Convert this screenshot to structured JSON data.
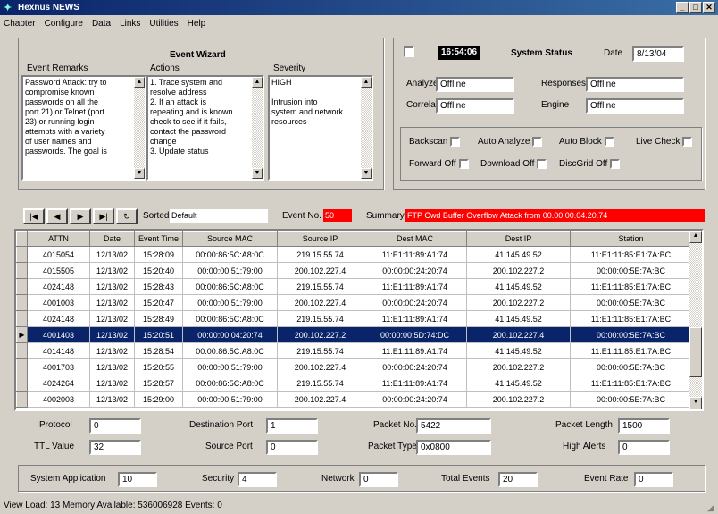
{
  "window": {
    "title": "Hexnus NEWS"
  },
  "menu": [
    "Chapter",
    "Configure",
    "Data",
    "Links",
    "Utilities",
    "Help"
  ],
  "wizard": {
    "title": "Event Wizard",
    "remarks_label": "Event Remarks",
    "actions_label": "Actions",
    "severity_label": "Severity",
    "remarks_lines": [
      "Password Attack: try to",
      "compromise known",
      "passwords on all the",
      "port 21) or Telnet (port",
      "23) or running login",
      "attempts with a variety",
      "of user names and",
      "passwords. The goal is"
    ],
    "actions_lines": [
      "1. Trace system and",
      "resolve address",
      "2. If an attack is",
      "repeating and is known",
      "check to see if it fails,",
      "contact the password",
      "change",
      "3. Update status"
    ],
    "severity_lines": [
      "HIGH",
      "",
      "Intrusion into",
      "system and network",
      "resources"
    ]
  },
  "status_panel": {
    "time_value": "16:54:06",
    "system_status_label": "System Status",
    "date_label": "Date",
    "date_value": "8/13/04",
    "analyzer_label": "Analyzer",
    "analyzer_value": "Offline",
    "responses_label": "Responses",
    "responses_value": "Offline",
    "correlation_label": "Correlation",
    "correlation_value": "Offline",
    "engine_label": "Engine",
    "engine_value": "Offline",
    "checks": [
      "Backscan",
      "Auto Analyze",
      "Auto Block",
      "Live Check",
      "Forward Off",
      "Download Off",
      "DiscGrid Off"
    ]
  },
  "nav": {
    "buttons": [
      "|◀",
      "◀",
      "▶",
      "▶|",
      "↻"
    ],
    "sorting_label": "Sorted",
    "sorting_value": "Default",
    "event_no_label": "Event No.",
    "event_no_value": "50",
    "summary_label": "Summary",
    "summary_value": "FTP Cwd Buffer Overflow Attack from 00.00.00.04.20.74"
  },
  "table": {
    "columns": [
      "ATTN",
      "Date",
      "Event Time",
      "Source MAC",
      "Source IP",
      "Dest MAC",
      "Dest IP",
      "Station"
    ],
    "rows": [
      [
        "4015054",
        "12/13/02",
        "15:28:09",
        "00:00:86:5C:A8:0C",
        "219.15.55.74",
        "11:E1:11:89:A1:74",
        "41.145.49.52",
        "11:E1:11:85:E1:7A:BC"
      ],
      [
        "4015505",
        "12/13/02",
        "15:20:40",
        "00:00:00:51:79:00",
        "200.102.227.4",
        "00:00:00:24:20:74",
        "200.102.227.2",
        "00:00:00:5E:7A:BC"
      ],
      [
        "4024148",
        "12/13/02",
        "15:28:43",
        "00:00:86:5C:A8:0C",
        "219.15.55.74",
        "11:E1:11:89:A1:74",
        "41.145.49.52",
        "11:E1:11:85:E1:7A:BC"
      ],
      [
        "4001003",
        "12/13/02",
        "15:20:47",
        "00:00:00:51:79:00",
        "200.102.227.4",
        "00:00:00:24:20:74",
        "200.102.227.2",
        "00:00:00:5E:7A:BC"
      ],
      [
        "4024148",
        "12/13/02",
        "15:28:49",
        "00:00:86:5C:A8:0C",
        "219.15.55.74",
        "11:E1:11:89:A1:74",
        "41.145.49.52",
        "11:E1:11:85:E1:7A:BC"
      ],
      [
        "4001403",
        "12/13/02",
        "15:20:51",
        "00:00:00:04:20:74",
        "200.102.227.2",
        "00:00:00:5D:74:DC",
        "200.102.227.4",
        "00:00:00:5E:7A:BC"
      ],
      [
        "4014148",
        "12/13/02",
        "15:28:54",
        "00:00:86:5C:A8:0C",
        "219.15.55.74",
        "11:E1:11:89:A1:74",
        "41.145.49.52",
        "11:E1:11:85:E1:7A:BC"
      ],
      [
        "4001703",
        "12/13/02",
        "15:20:55",
        "00:00:00:51:79:00",
        "200.102.227.4",
        "00:00:00:24:20:74",
        "200.102.227.2",
        "00:00:00:5E:7A:BC"
      ],
      [
        "4024264",
        "12/13/02",
        "15:28:57",
        "00:00:86:5C:A8:0C",
        "219.15.55.74",
        "11:E1:11:89:A1:74",
        "41.145.49.52",
        "11:E1:11:85:E1:7A:BC"
      ],
      [
        "4002003",
        "12/13/02",
        "15:29:00",
        "00:00:00:51:79:00",
        "200.102.227.4",
        "00:00:00:24:20:74",
        "200.102.227.2",
        "00:00:00:5E:7A:BC"
      ]
    ],
    "selected_row": 5
  },
  "details": {
    "protocol_label": "Protocol",
    "protocol_value": "0",
    "dest_port_label": "Destination Port",
    "dest_port_value": "1",
    "packet_no_label": "Packet No.",
    "packet_no_value": "5422",
    "packet_length_label": "Packet Length",
    "packet_length_value": "1500",
    "ttl_label": "TTL Value",
    "ttl_value": "32",
    "source_port_label": "Source Port",
    "source_port_value": "0",
    "packet_type_label": "Packet Type",
    "packet_type_value": "0x0800",
    "high_alerts_label": "High Alerts",
    "high_alerts_value": "0"
  },
  "counters": {
    "sys_app_label": "System Application",
    "sys_app_value": "10",
    "security_label": "Security",
    "security_value": "4",
    "network_label": "Network",
    "network_value": "0",
    "total_label": "Total Events",
    "total_value": "20",
    "rate_label": "Event Rate",
    "rate_value": "0"
  },
  "statusbar": {
    "text": "View Load: 13  Memory Available: 536006928  Events: 0"
  },
  "colors": {
    "title_start": "#0a246a",
    "title_end": "#3a6ea5",
    "selection": "#0a246a",
    "alert": "#ff0000",
    "face": "#d4d0c8"
  }
}
